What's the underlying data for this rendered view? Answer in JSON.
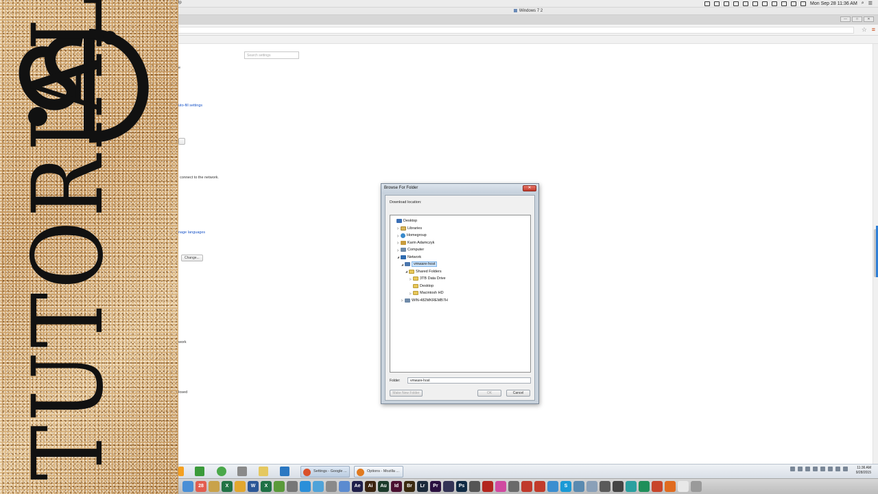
{
  "branding": {
    "monogram": "SD",
    "word": "TUTORIALS"
  },
  "mac_menu_bar": {
    "menu_fragment": "lp",
    "clock": "Mon Sep 28  11:36 AM"
  },
  "vm_window": {
    "title": "Windows 7 2"
  },
  "browser": {
    "window_buttons": [
      "—",
      "□",
      "✕"
    ]
  },
  "settings": {
    "search_placeholder": "Search settings",
    "fragments": {
      "f1": "e",
      "autofill_link": "uto-fill settings",
      "network_text": "connect to the network.",
      "languages_link": "nage languages",
      "change_button": "Change...",
      "work": "work",
      "closed": "losed"
    }
  },
  "dialog": {
    "title": "Browse For Folder",
    "close_label": "✕",
    "prompt": "Download location:",
    "tree": [
      {
        "label": "Desktop",
        "icon": "desktop-icon",
        "expander": ""
      },
      {
        "label": "Libraries",
        "icon": "libraries-icon",
        "expander": "▷"
      },
      {
        "label": "Homegroup",
        "icon": "homegroup-icon",
        "expander": "▷"
      },
      {
        "label": "Karin Adamczyk",
        "icon": "user-folder-icon",
        "expander": "▷"
      },
      {
        "label": "Computer",
        "icon": "computer-icon",
        "expander": "▷"
      },
      {
        "label": "Network",
        "icon": "network-icon",
        "expander": "◢"
      },
      {
        "label": "vmware-host",
        "icon": "host-icon",
        "expander": "◢",
        "selected": true
      },
      {
        "label": "Shared Folders",
        "icon": "folder-icon",
        "expander": "◢"
      },
      {
        "label": "3TB Data Drive",
        "icon": "folder-icon",
        "expander": "▷"
      },
      {
        "label": "Desktop",
        "icon": "folder-icon",
        "expander": ""
      },
      {
        "label": "Macintosh HD",
        "icon": "folder-icon",
        "expander": "▷"
      },
      {
        "label": "WIN-482MKREMB7H",
        "icon": "computer-icon",
        "expander": "▷"
      }
    ],
    "folder_label": "Folder:",
    "folder_value": "vmware-host",
    "make_new_folder": "Make New Folder",
    "ok": "OK",
    "cancel": "Cancel"
  },
  "taskbar": {
    "tasks": [
      {
        "label": "Settings - Google ...",
        "active": true
      },
      {
        "label": "Options - Mozilla ...",
        "active": false
      }
    ],
    "clock_time": "11:36 AM",
    "clock_date": "9/28/2015"
  },
  "dock": {
    "apps": [
      {
        "name": "Finder",
        "letter": "",
        "color": "#4a8fd6"
      },
      {
        "name": "Calendar",
        "letter": "28",
        "color": "#e35d4f"
      },
      {
        "name": "Notes",
        "letter": "",
        "color": "#c9a24a"
      },
      {
        "name": "Excel",
        "letter": "X",
        "color": "#217346"
      },
      {
        "name": "Chrome",
        "letter": "",
        "color": "#e2a72e"
      },
      {
        "name": "Word",
        "letter": "W",
        "color": "#2b5797"
      },
      {
        "name": "Excel",
        "letter": "X",
        "color": "#1e7145"
      },
      {
        "name": "Preview",
        "letter": "",
        "color": "#5a9a3a"
      },
      {
        "name": "Settings",
        "letter": "",
        "color": "#777777"
      },
      {
        "name": "Safari",
        "letter": "",
        "color": "#2b8fd9"
      },
      {
        "name": "Photos",
        "letter": "",
        "color": "#4fa3d9"
      },
      {
        "name": "Image Capture",
        "letter": "",
        "color": "#8a8a8a"
      },
      {
        "name": "Mail",
        "letter": "",
        "color": "#5b8bd0"
      },
      {
        "name": "After Effects",
        "letter": "Ae",
        "color": "#1f1f4a"
      },
      {
        "name": "Illustrator",
        "letter": "Ai",
        "color": "#3b2410"
      },
      {
        "name": "Audition",
        "letter": "Au",
        "color": "#1b3a2a"
      },
      {
        "name": "InDesign",
        "letter": "Id",
        "color": "#4a1030"
      },
      {
        "name": "Bridge",
        "letter": "Br",
        "color": "#3a2a10"
      },
      {
        "name": "Lightroom",
        "letter": "Lr",
        "color": "#1b2a3a"
      },
      {
        "name": "Premiere",
        "letter": "Pr",
        "color": "#2a1040"
      },
      {
        "name": "Encoder",
        "letter": "",
        "color": "#333355"
      },
      {
        "name": "Photoshop",
        "letter": "Ps",
        "color": "#0f2a44"
      },
      {
        "name": "Media",
        "letter": "",
        "color": "#555555"
      },
      {
        "name": "Acrobat",
        "letter": "",
        "color": "#b3261e"
      },
      {
        "name": "iTunes",
        "letter": "",
        "color": "#d04aa0"
      },
      {
        "name": "Tools",
        "letter": "",
        "color": "#6a6a6a"
      },
      {
        "name": "App",
        "letter": "",
        "color": "#c0392b"
      },
      {
        "name": "Photo Booth",
        "letter": "",
        "color": "#c23b2a"
      },
      {
        "name": "Chrome",
        "letter": "",
        "color": "#3b8ed0"
      },
      {
        "name": "Skype",
        "letter": "S",
        "color": "#1a9ad6"
      },
      {
        "name": "Maps",
        "letter": "",
        "color": "#5a8ab0"
      },
      {
        "name": "Folder",
        "letter": "",
        "color": "#8aa0b8"
      },
      {
        "name": "Utilities",
        "letter": "",
        "color": "#5a5a5a"
      },
      {
        "name": "Console",
        "letter": "",
        "color": "#444444"
      },
      {
        "name": "Game",
        "letter": "",
        "color": "#2aa0a0"
      },
      {
        "name": "Chrome",
        "letter": "",
        "color": "#1f8f5a"
      },
      {
        "name": "Pinwheel",
        "letter": "",
        "color": "#c8452a"
      },
      {
        "name": "Firefox",
        "letter": "",
        "color": "#e06b1f"
      },
      {
        "name": "Document",
        "letter": "",
        "color": "#e8e8e8"
      },
      {
        "name": "Trash",
        "letter": "",
        "color": "#9a9a9a"
      }
    ]
  }
}
